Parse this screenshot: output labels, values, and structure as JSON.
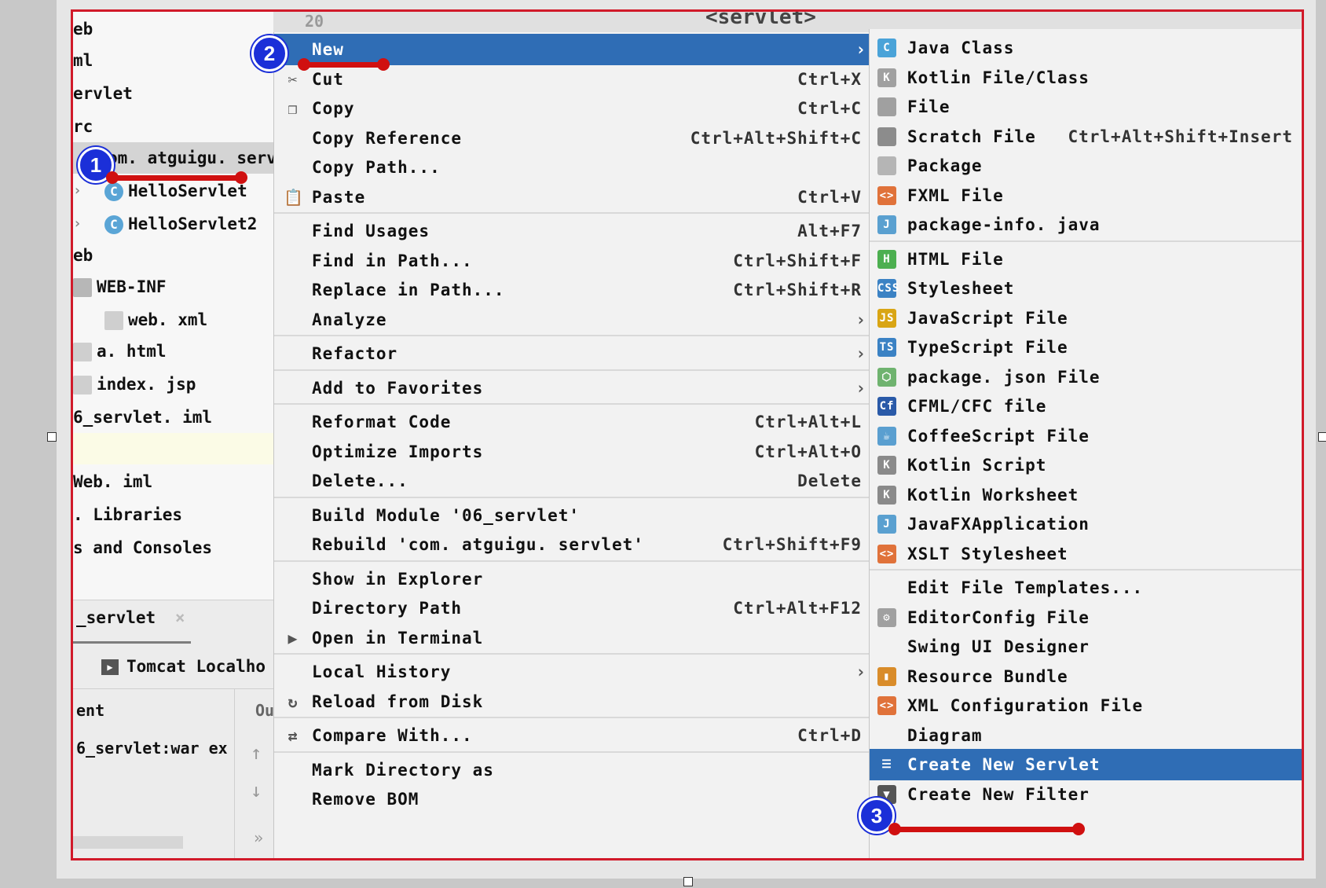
{
  "top_strip": {
    "line_no": "20",
    "tag": "<servlet>"
  },
  "tree": [
    {
      "label": "eb",
      "kind": "text"
    },
    {
      "label": "ml",
      "kind": "text"
    },
    {
      "label": "ervlet",
      "kind": "text"
    },
    {
      "label": "rc",
      "kind": "text"
    },
    {
      "label": "om. atguigu. servl",
      "kind": "selected"
    },
    {
      "label": "HelloServlet",
      "kind": "class"
    },
    {
      "label": "HelloServlet2",
      "kind": "class"
    },
    {
      "label": "eb",
      "kind": "text"
    },
    {
      "label": "WEB-INF",
      "kind": "folder"
    },
    {
      "label": "web. xml",
      "kind": "file"
    },
    {
      "label": "a. html",
      "kind": "file"
    },
    {
      "label": "index. jsp",
      "kind": "file"
    },
    {
      "label": "6_servlet. iml",
      "kind": "text"
    },
    {
      "label": "",
      "kind": "highlight"
    },
    {
      "label": "Web. iml",
      "kind": "text"
    },
    {
      "label": ". Libraries",
      "kind": "text"
    },
    {
      "label": "s and Consoles",
      "kind": "text"
    }
  ],
  "bottom_pane": {
    "tab": "_servlet",
    "tab_close": "×",
    "tomcat": "Tomcat Localho",
    "col_ent": "ent",
    "col_ou": "Ou",
    "artifact": "6_servlet:war ex",
    "more": "»"
  },
  "menu": [
    {
      "label": "New",
      "shortcut": "",
      "arrow": true,
      "icon": "",
      "active": true
    },
    {
      "label": "Cut",
      "shortcut": "Ctrl+X",
      "icon": "✂"
    },
    {
      "label": "Copy",
      "shortcut": "Ctrl+C",
      "icon": "❐"
    },
    {
      "label": "Copy Reference",
      "shortcut": "Ctrl+Alt+Shift+C",
      "icon": ""
    },
    {
      "label": "Copy Path...",
      "shortcut": "",
      "icon": ""
    },
    {
      "label": "Paste",
      "shortcut": "Ctrl+V",
      "icon": "📋"
    },
    {
      "sep": true
    },
    {
      "label": "Find Usages",
      "shortcut": "Alt+F7",
      "icon": ""
    },
    {
      "label": "Find in Path...",
      "shortcut": "Ctrl+Shift+F",
      "icon": ""
    },
    {
      "label": "Replace in Path...",
      "shortcut": "Ctrl+Shift+R",
      "icon": ""
    },
    {
      "label": "Analyze",
      "shortcut": "",
      "arrow": true,
      "icon": ""
    },
    {
      "sep": true
    },
    {
      "label": "Refactor",
      "shortcut": "",
      "arrow": true,
      "icon": ""
    },
    {
      "sep": true
    },
    {
      "label": "Add to Favorites",
      "shortcut": "",
      "arrow": true,
      "icon": ""
    },
    {
      "sep": true
    },
    {
      "label": "Reformat Code",
      "shortcut": "Ctrl+Alt+L",
      "icon": ""
    },
    {
      "label": "Optimize Imports",
      "shortcut": "Ctrl+Alt+O",
      "icon": ""
    },
    {
      "label": "Delete...",
      "shortcut": "Delete",
      "icon": ""
    },
    {
      "sep": true
    },
    {
      "label": "Build Module '06_servlet'",
      "shortcut": "",
      "icon": ""
    },
    {
      "label": "Rebuild 'com. atguigu. servlet'",
      "shortcut": "Ctrl+Shift+F9",
      "icon": ""
    },
    {
      "sep": true
    },
    {
      "label": "Show in Explorer",
      "shortcut": "",
      "icon": ""
    },
    {
      "label": "Directory Path",
      "shortcut": "Ctrl+Alt+F12",
      "icon": ""
    },
    {
      "label": "Open in Terminal",
      "shortcut": "",
      "icon": "▶"
    },
    {
      "sep": true
    },
    {
      "label": "Local History",
      "shortcut": "",
      "arrow": true,
      "icon": ""
    },
    {
      "label": "Reload from Disk",
      "shortcut": "",
      "icon": "↻"
    },
    {
      "sep": true
    },
    {
      "label": "Compare With...",
      "shortcut": "Ctrl+D",
      "icon": "⇄"
    },
    {
      "sep": true
    },
    {
      "label": "Mark Directory as",
      "shortcut": "",
      "icon": ""
    },
    {
      "label": "Remove BOM",
      "shortcut": "",
      "icon": ""
    }
  ],
  "submenu": [
    {
      "label": "Java Class",
      "shortcut": "",
      "icon": "C",
      "color": "#4aa3d8"
    },
    {
      "label": "Kotlin File/Class",
      "shortcut": "",
      "icon": "K",
      "color": "#a0a0a0"
    },
    {
      "label": "File",
      "shortcut": "",
      "icon": "",
      "color": "#a0a0a0"
    },
    {
      "label": "Scratch File",
      "shortcut": "Ctrl+Alt+Shift+Insert",
      "icon": "",
      "color": "#8c8c8c"
    },
    {
      "label": "Package",
      "shortcut": "",
      "icon": "",
      "color": "#b5b5b5"
    },
    {
      "label": "FXML File",
      "shortcut": "",
      "icon": "<>",
      "color": "#e0723a"
    },
    {
      "label": "package-info. java",
      "shortcut": "",
      "icon": "J",
      "color": "#5aa0d0"
    },
    {
      "sep": true
    },
    {
      "label": "HTML File",
      "shortcut": "",
      "icon": "H",
      "color": "#4caf50"
    },
    {
      "label": "Stylesheet",
      "shortcut": "",
      "icon": "CSS",
      "color": "#3b82c4"
    },
    {
      "label": "JavaScript File",
      "shortcut": "",
      "icon": "JS",
      "color": "#d9a514"
    },
    {
      "label": "TypeScript File",
      "shortcut": "",
      "icon": "TS",
      "color": "#3b82c4"
    },
    {
      "label": "package. json File",
      "shortcut": "",
      "icon": "⬡",
      "color": "#6fb36f"
    },
    {
      "label": "CFML/CFC file",
      "shortcut": "",
      "icon": "Cf",
      "color": "#2a5aa8"
    },
    {
      "label": "CoffeeScript File",
      "shortcut": "",
      "icon": "☕",
      "color": "#5a9fd0"
    },
    {
      "label": "Kotlin Script",
      "shortcut": "",
      "icon": "K",
      "color": "#8a8a8a"
    },
    {
      "label": "Kotlin Worksheet",
      "shortcut": "",
      "icon": "K",
      "color": "#8a8a8a"
    },
    {
      "label": "JavaFXApplication",
      "shortcut": "",
      "icon": "J",
      "color": "#5aa0d0"
    },
    {
      "label": "XSLT Stylesheet",
      "shortcut": "",
      "icon": "<>",
      "color": "#e0723a"
    },
    {
      "sep": true
    },
    {
      "label": "Edit File Templates...",
      "shortcut": "",
      "icon": "",
      "color": ""
    },
    {
      "label": "EditorConfig File",
      "shortcut": "",
      "icon": "⚙",
      "color": "#a0a0a0"
    },
    {
      "label": "Swing UI Designer",
      "shortcut": "",
      "icon": "",
      "color": "",
      "arrow": true
    },
    {
      "label": "Resource Bundle",
      "shortcut": "",
      "icon": "▮",
      "color": "#d98c2a"
    },
    {
      "label": "XML Configuration File",
      "shortcut": "",
      "icon": "<>",
      "color": "#e0723a",
      "arrow": true
    },
    {
      "label": "Diagram",
      "shortcut": "",
      "icon": "",
      "color": "",
      "arrow": true
    },
    {
      "label": "Create New Servlet",
      "shortcut": "",
      "icon": "☰",
      "color": "#2f6db5",
      "active": true
    },
    {
      "label": "Create New Filter",
      "shortcut": "",
      "icon": "▼",
      "color": "#555555"
    }
  ],
  "annotations": [
    "1",
    "2",
    "3"
  ],
  "colors": {
    "accent": "#2f6db5",
    "marker_red": "#d01010",
    "badge_blue": "#1b2fd8",
    "frame_red": "#d11a2a"
  }
}
